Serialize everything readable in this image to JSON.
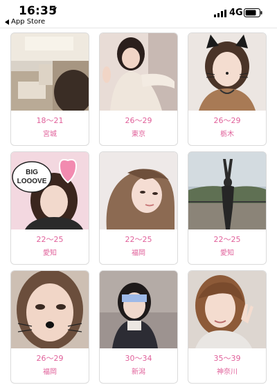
{
  "status_bar": {
    "time": "16:35",
    "network": "4G",
    "back_label": "App Store"
  },
  "profiles": [
    {
      "age": "18〜21",
      "prefecture": "宮城"
    },
    {
      "age": "26〜29",
      "prefecture": "東京"
    },
    {
      "age": "26〜29",
      "prefecture": "栃木"
    },
    {
      "age": "22〜25",
      "prefecture": "愛知"
    },
    {
      "age": "22〜25",
      "prefecture": "福岡"
    },
    {
      "age": "22〜25",
      "prefecture": "愛知"
    },
    {
      "age": "26〜29",
      "prefecture": "福岡"
    },
    {
      "age": "30〜34",
      "prefecture": "新潟"
    },
    {
      "age": "35〜39",
      "prefecture": "神奈川"
    }
  ],
  "photo_overlays": {
    "sticker_text_line1": "BIG",
    "sticker_text_line2": "LOOOVE"
  },
  "colors": {
    "accent_pink": "#e0609a",
    "card_border": "#dadada"
  }
}
